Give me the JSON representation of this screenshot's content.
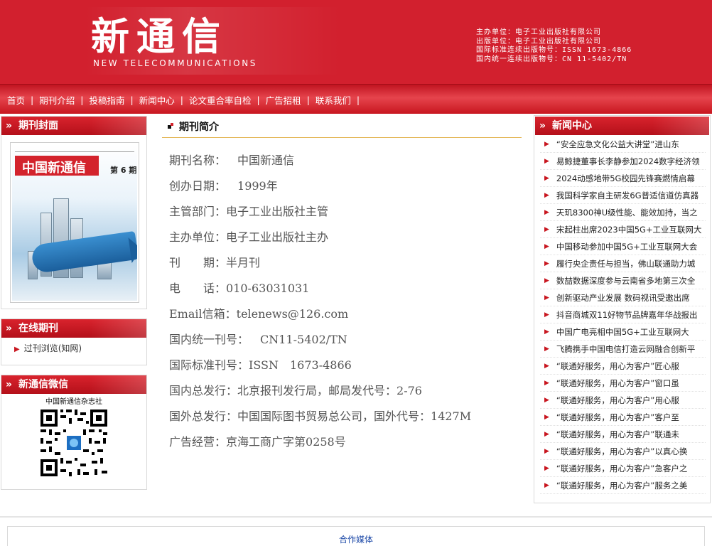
{
  "header": {
    "logo_cn": "新通信",
    "logo_en": "NEW TELECOMMUNICATIONS",
    "info": [
      "主办单位：电子工业出版社有限公司",
      "出版单位：电子工业出版社有限公司",
      "国际标准连续出版物号：ISSN 1673-4866",
      "国内统一连续出版物号：CN 11-5402/TN"
    ]
  },
  "nav": {
    "items": [
      "首页",
      "期刊介绍",
      "投稿指南",
      "新闻中心",
      "论文重合率自检",
      "广告招租",
      "联系我们"
    ]
  },
  "left": {
    "cover_title": "期刊封面",
    "cover_image": {
      "magazine_name": "中国新通信",
      "issue": "第 6 期"
    },
    "online_title": "在线期刊",
    "online_links": [
      "过刊浏览(知网)"
    ],
    "wechat_title": "新通信微信",
    "qr_caption": "中国新通信杂志社"
  },
  "center": {
    "section_title": "期刊简介",
    "rows": [
      {
        "label": "期刊名称：",
        "value": "　中国新通信"
      },
      {
        "label": "创办日期：",
        "value": "　1999年"
      },
      {
        "label": "主管部门：",
        "value": "电子工业出版社主管"
      },
      {
        "label": "主办单位：",
        "value": "电子工业出版社主办"
      },
      {
        "label": "刊　　期：",
        "value": "半月刊"
      },
      {
        "label": "电　　话：",
        "value": "010-63031031"
      },
      {
        "label": "Email信箱：",
        "value": "telenews@126.com"
      },
      {
        "label": "国内统一刊号：",
        "value": "　CN11-5402/TN"
      },
      {
        "label": "国际标准刊号：",
        "value": "ISSN　1673-4866"
      },
      {
        "label": "国内总发行：",
        "value": "北京报刊发行局，邮局发代号：2-76"
      },
      {
        "label": "国外总发行：",
        "value": "中国国际图书贸易总公司，国外代号：1427M"
      },
      {
        "label": "广告经营：",
        "value": "京海工商广字第0258号"
      }
    ]
  },
  "news": {
    "title": "新闻中心",
    "items": [
      "“安全应急文化公益大讲堂”进山东",
      "易鲸捷董事长李静参加2024数字经济领",
      "2024动感地带5G校园先锋赛燃情启幕",
      "我国科学家自主研发6G普适信道仿真器",
      "天玑8300神U级性能、能效加持，当之",
      "宋起柱出席2023中国5G+工业互联网大",
      "中国移动参加中国5G+工业互联网大会",
      "履行央企责任与担当，佛山联通助力城",
      "数喆数据深度参与云南省多地第三次全",
      "创新驱动产业发展 数码视讯受邀出席",
      "抖音商城双11好物节品牌嘉年华战报出",
      "中国广电亮相中国5G+工业互联网大",
      "飞腾携手中国电信打造云网融合创新平",
      "“联通好服务，用心为客户”匠心服",
      "“联通好服务，用心为客户”窗口虽",
      "“联通好服务，用心为客户”用心服",
      "“联通好服务，用心为客户”客户至",
      "“联通好服务，用心为客户”联通未",
      "“联通好服务，用心为客户”以真心换",
      "“联通好服务，用心为客户”急客户之",
      "“联通好服务，用心为客户”服务之美"
    ]
  },
  "footer": {
    "partner_label": "合作媒体"
  },
  "colors": {
    "brand_red": "#d2202e",
    "news_triangle": "#c8161f",
    "center_rule": "#e2b34d",
    "partner_link": "#1e4aa8"
  }
}
